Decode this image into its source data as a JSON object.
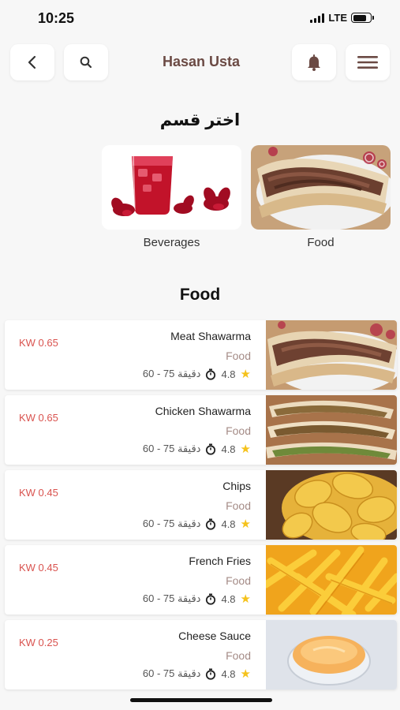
{
  "status_bar": {
    "time": "10:25",
    "network": "LTE",
    "battery_level": 0.8
  },
  "header": {
    "title": "Hasan Usta",
    "back_icon": "chevron-left-icon",
    "search_icon": "search-icon",
    "bell_icon": "bell-icon",
    "menu_icon": "hamburger-menu-icon"
  },
  "categories_section": {
    "title": "اختر قسم",
    "items": [
      {
        "label": "Beverages",
        "image": "hibiscus-drink"
      },
      {
        "label": "Food",
        "image": "shawarma-plate"
      }
    ]
  },
  "list_section": {
    "title": "Food",
    "items": [
      {
        "name": "Meat Shawarma",
        "category": "Food",
        "price": "KW 0.65",
        "rating": "4.8",
        "time": "60 - 75 دقيقة",
        "image": "meat-shawarma"
      },
      {
        "name": "Chicken Shawarma",
        "category": "Food",
        "price": "KW 0.65",
        "rating": "4.8",
        "time": "60 - 75 دقيقة",
        "image": "chicken-shawarma"
      },
      {
        "name": "Chips",
        "category": "Food",
        "price": "KW 0.45",
        "rating": "4.8",
        "time": "60 - 75 دقيقة",
        "image": "chips"
      },
      {
        "name": "French Fries",
        "category": "Food",
        "price": "KW 0.45",
        "rating": "4.8",
        "time": "60 - 75 دقيقة",
        "image": "french-fries"
      },
      {
        "name": "Cheese Sauce",
        "category": "Food",
        "price": "KW 0.25",
        "rating": "4.8",
        "time": "60 - 75 دقيقة",
        "image": "cheese-sauce"
      }
    ]
  },
  "colors": {
    "accent": "#6b4a44",
    "price": "#d9534f",
    "star": "#f5c21b"
  }
}
